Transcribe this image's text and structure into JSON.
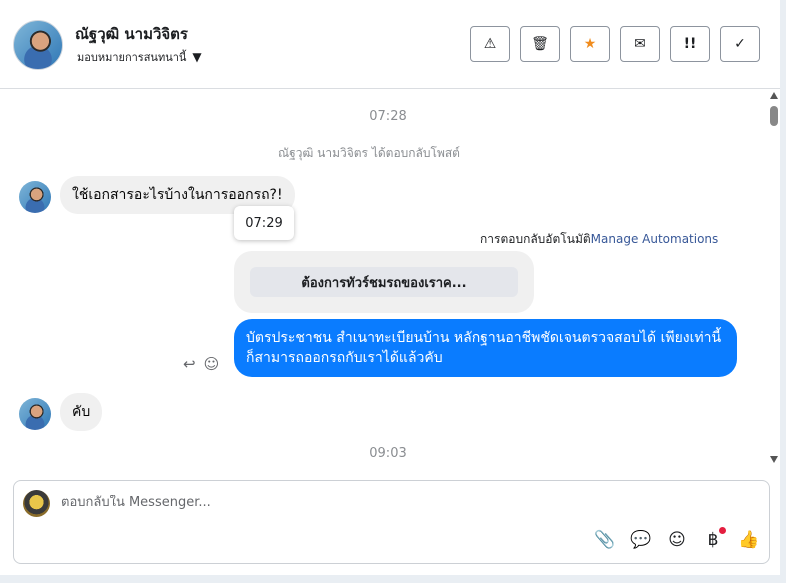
{
  "header": {
    "contact_name": "ณัฐวุฒิ นามวิจิตร",
    "assign_label": "มอบหมายการสนทนานี้",
    "actions": [
      {
        "icon": "warning-icon",
        "glyph": "⚠"
      },
      {
        "icon": "trash-icon",
        "glyph": "🗑"
      },
      {
        "icon": "star-icon",
        "glyph": "★"
      },
      {
        "icon": "envelope-open-icon",
        "glyph": "✉"
      },
      {
        "icon": "follow-up-icon",
        "glyph": "!!"
      },
      {
        "icon": "check-icon",
        "glyph": "✓"
      }
    ]
  },
  "chat": {
    "time_1": "07:28",
    "system_note": "ณัฐวุฒิ นามวิจิตร ได้ตอบกลับโพสต์",
    "msg_in_1": "ใช้เอกสารอะไรบ้างในการออกรถ?!",
    "tooltip_time": "07:29",
    "automation_label": "การตอบกลับอัตโนมัติ",
    "automation_link": "Manage Automations",
    "automation_button": "ต้องการทัวร์ชมรถของเราค...",
    "msg_out_1": "บัตรประชาชน สำเนาทะเบียนบ้าน หลักฐานอาชีพชัดเจนตรวจสอบได้ เพียงเท่านี้ก็สามารถออกรถกับเราได้แล้วคับ",
    "msg_in_2": "คับ",
    "time_2": "09:03"
  },
  "composer": {
    "placeholder": "ตอบกลับใน Messenger...",
    "tools": [
      {
        "icon": "paperclip-icon",
        "glyph": "📎"
      },
      {
        "icon": "saved-reply-icon",
        "glyph": "💬"
      },
      {
        "icon": "emoji-icon",
        "glyph": "☺"
      },
      {
        "icon": "baht-icon",
        "glyph": "฿"
      },
      {
        "icon": "thumbs-up-icon",
        "glyph": "👍"
      }
    ]
  },
  "colors": {
    "outgoing_bubble": "#0a7cff",
    "incoming_bubble": "#f0f0f0",
    "star": "#f08c1e",
    "link": "#385898"
  }
}
